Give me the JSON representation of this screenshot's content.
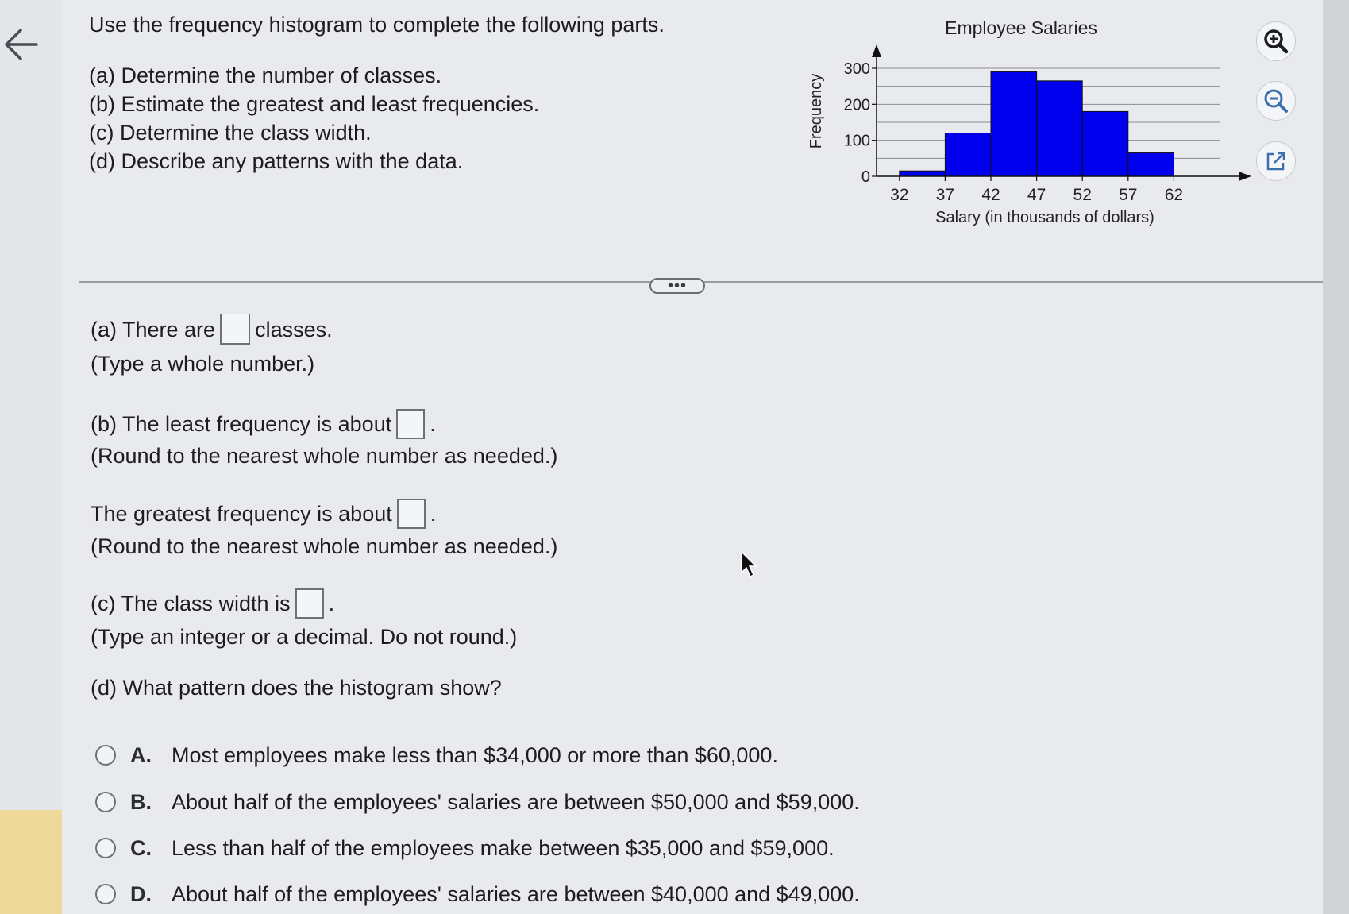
{
  "question": {
    "intro": "Use the frequency histogram to complete the following parts.",
    "parts": [
      "(a) Determine the number of classes.",
      "(b) Estimate the greatest and least frequencies.",
      "(c) Determine the class width.",
      "(d) Describe any patterns with the data."
    ]
  },
  "answers": {
    "a_prefix": "(a) There are",
    "a_suffix": "classes.",
    "a_hint": "(Type a whole number.)",
    "b_least_prefix": "(b) The least frequency is about",
    "b_hint1": "(Round to the nearest whole number as needed.)",
    "b_greatest_prefix": "The greatest frequency is about",
    "b_hint2": "(Round to the nearest whole number as needed.)",
    "c_prefix": "(c) The class width is",
    "c_hint": "(Type an integer or a decimal. Do not round.)",
    "d_prompt": "(d) What pattern does the histogram show?",
    "period": "."
  },
  "options": [
    {
      "letter": "A.",
      "text": "Most employees make less than $34,000 or more than $60,000."
    },
    {
      "letter": "B.",
      "text": "About half of the employees' salaries are between $50,000 and $59,000."
    },
    {
      "letter": "C.",
      "text": "Less than half of the employees make between $35,000 and $59,000."
    },
    {
      "letter": "D.",
      "text": "About half of the employees' salaries are between $40,000 and $49,000."
    }
  ],
  "more_label": "•••",
  "icons": [
    "back-arrow-icon",
    "zoom-in-icon",
    "zoom-out-icon",
    "external-link-icon"
  ],
  "chart_data": {
    "type": "bar",
    "title": "Employee Salaries",
    "xlabel": "Salary (in thousands of dollars)",
    "ylabel": "Frequency",
    "x_ticks": [
      32,
      37,
      42,
      47,
      52,
      57,
      62
    ],
    "y_ticks": [
      0,
      100,
      200,
      300
    ],
    "bin_edges": [
      32,
      37,
      42,
      47,
      52,
      57,
      62
    ],
    "values": [
      15,
      120,
      290,
      265,
      180,
      65
    ],
    "xlim": [
      29.5,
      67
    ],
    "ylim": [
      0,
      300
    ],
    "bar_color": "#0000ee",
    "grid": true
  }
}
